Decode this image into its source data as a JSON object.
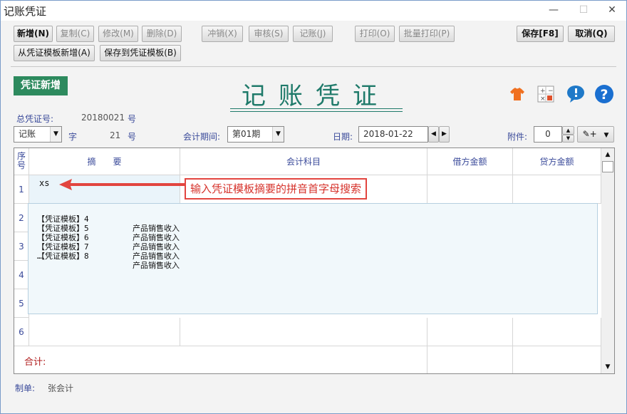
{
  "window": {
    "title": "记账凭证",
    "controls": [
      "—",
      "☐",
      "✕"
    ]
  },
  "toolbar": {
    "row1": [
      {
        "label": "新增(N)",
        "enabled": true
      },
      {
        "label": "复制(C)",
        "enabled": false
      },
      {
        "label": "修改(M)",
        "enabled": false
      },
      {
        "label": "删除(D)",
        "enabled": false
      },
      {
        "label": "冲销(X)",
        "enabled": false
      },
      {
        "label": "审核(S)",
        "enabled": false
      },
      {
        "label": "记账(J)",
        "enabled": false
      },
      {
        "label": "打印(O)",
        "enabled": false
      },
      {
        "label": "批量打印(P)",
        "enabled": false
      }
    ],
    "row2": [
      {
        "label": "从凭证模板新增(A)"
      },
      {
        "label": "保存到凭证模板(B)"
      }
    ],
    "save_label": "保存[F8]",
    "cancel_label": "取消(Q)"
  },
  "voucher": {
    "badge": "凭证新增",
    "big_title": "记账凭证",
    "total_no_label": "总凭证号:",
    "total_no_value": "20180021",
    "hao1": "号",
    "type_value": "记账",
    "zi_label": "字",
    "zi_no": "21",
    "hao2": "号",
    "period_label": "会计期间:",
    "period_value": "第01期",
    "date_label": "日期:",
    "date_value": "2018-01-22",
    "attach_label": "附件:",
    "attach_value": "0"
  },
  "table": {
    "headers": {
      "seq": "序号",
      "summary": "摘　　要",
      "account": "会计科目",
      "debit": "借方金额",
      "credit": "贷方金额"
    },
    "rows": [
      "1",
      "2",
      "3",
      "4",
      "5",
      "6"
    ],
    "input_text": "xs",
    "total_label": "合计:"
  },
  "popup": {
    "items": [
      {
        "name": "【凭证模板】4",
        "desc": "产品销售收入"
      },
      {
        "name": "【凭证模板】5",
        "desc": "产品销售收入"
      },
      {
        "name": "【凭证模板】6",
        "desc": "产品销售收入"
      },
      {
        "name": "【凭证模板】7",
        "desc": "产品销售收入"
      },
      {
        "name": "【凭证模板】8",
        "desc": "产品销售收入"
      }
    ],
    "more": "…"
  },
  "annotation": {
    "text": "输入凭证模板摘要的拼音首字母搜索",
    "color": "#e2453f"
  },
  "footer": {
    "maker_label": "制单:",
    "maker_value": "张会计"
  },
  "icons": [
    "shirt-icon",
    "calculator-icon",
    "chat-icon",
    "help-icon"
  ]
}
